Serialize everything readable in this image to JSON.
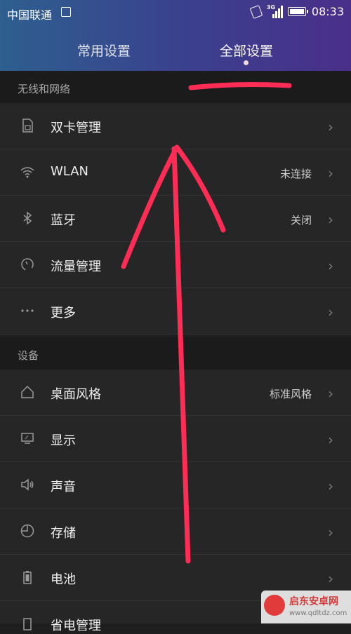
{
  "status_bar": {
    "carrier": "中国联通",
    "network": "3G",
    "time": "08:33"
  },
  "tabs": [
    {
      "label": "常用设置"
    },
    {
      "label": "全部设置"
    }
  ],
  "sections": [
    {
      "title": "无线和网络"
    },
    {
      "title": "设备"
    }
  ],
  "rows": [
    {
      "label": "双卡管理",
      "value": ""
    },
    {
      "label": "WLAN",
      "value": "未连接"
    },
    {
      "label": "蓝牙",
      "value": "关闭"
    },
    {
      "label": "流量管理",
      "value": ""
    },
    {
      "label": "更多",
      "value": ""
    },
    {
      "label": "桌面风格",
      "value": "标准风格"
    },
    {
      "label": "显示",
      "value": ""
    },
    {
      "label": "声音",
      "value": ""
    },
    {
      "label": "存储",
      "value": ""
    },
    {
      "label": "电池",
      "value": ""
    },
    {
      "label": "省电管理",
      "value": ""
    }
  ],
  "chevron": "›",
  "watermark": {
    "title": "启东安卓网",
    "url": "www.qdltdz.com"
  },
  "colors": {
    "annotation": "#ff2d55",
    "header_start": "#2e5f8f",
    "header_end": "#4a2f8a"
  }
}
